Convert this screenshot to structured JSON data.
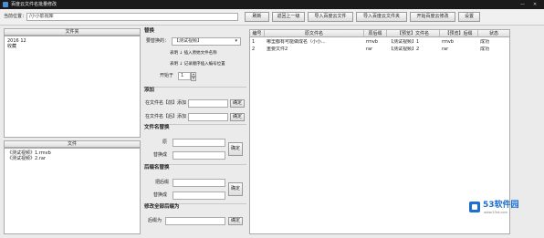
{
  "window": {
    "title": "百度云文件名批量修改",
    "minimize_label": "—",
    "close_label": "✕"
  },
  "toolbar": {
    "location_label": "当前位置：",
    "location_value": "/小小影视库",
    "refresh_button": "刷新",
    "back_button": "返回上一级",
    "import_files_button": "导入百度云文件",
    "import_folder_button": "导入百度云文件夹",
    "start_modify_button": "开始百度云修改",
    "settings_button": "设置"
  },
  "folder_panel": {
    "header": "文件夹",
    "items": [
      "2016 12",
      "收藏"
    ]
  },
  "file_panel": {
    "header": "文件",
    "items": [
      "《测试视频》1.rmvb",
      "《测试视频》2.rar"
    ]
  },
  "replace": {
    "section_title": "替换",
    "find_label": "要替换的：",
    "find_value": "【测试视频】",
    "arrow_icon": "dropdown-arrow",
    "hint1": "表明 ↓ 插入原始文件名称",
    "hint2": "表明 ↓ 记录顺序插入编号位置",
    "start_label": "开始于",
    "start_value": "1"
  },
  "add": {
    "section_title": "添加",
    "front_label": "在文件名【前】添加",
    "front_confirm": "确定",
    "back_label": "在文件名【后】添加",
    "back_confirm": "确定"
  },
  "rename_replace": {
    "section_title": "文件名替换",
    "original_label": "原",
    "replace_with_label": "替换成",
    "confirm": "确定"
  },
  "ext_replace": {
    "section_title": "后缀名替换",
    "original_label": "把后缀",
    "replace_with_label": "替换成",
    "confirm": "确定"
  },
  "rename_all": {
    "section_title": "修改全部后缀为",
    "label": "后缀为",
    "confirm": "确定"
  },
  "result_table": {
    "columns": [
      "编号",
      "原文件名",
      "原后缀",
      "【预览】文件名",
      "【预览】后缀",
      "状态"
    ],
    "rows": [
      [
        "1",
        "哪里都有可能做成名（小小...",
        "rmvb",
        "【测试视频】1",
        "rmvb",
        "成功"
      ],
      [
        "2",
        "重要文件2",
        "rar",
        "【测试视频】2",
        "rar",
        "成功"
      ]
    ]
  },
  "watermark": {
    "name": "53软件园",
    "url": "www.53xt.com",
    "color": "#1d6fd0"
  }
}
